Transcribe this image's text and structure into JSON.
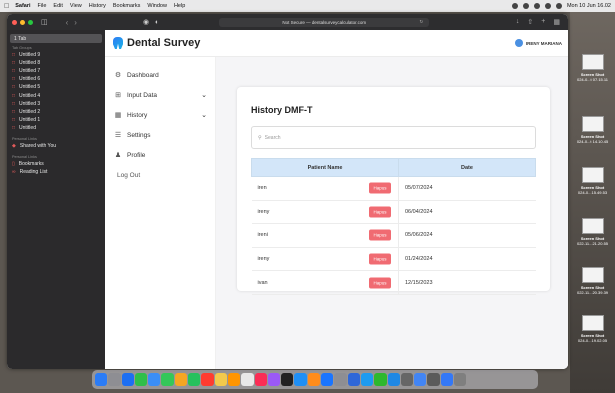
{
  "menubar": {
    "items": [
      "Safari",
      "File",
      "Edit",
      "View",
      "History",
      "Bookmarks",
      "Window",
      "Help"
    ],
    "clock": "Mon 10 Jun 16.02"
  },
  "browser": {
    "url": "Not Secure — dentalsurveycalculator.com",
    "sidebar": {
      "tab_label": "1 Tab",
      "groups_heading": "Tab Groups",
      "groups": [
        "Untitled 9",
        "Untitled 8",
        "Untitled 7",
        "Untitled 6",
        "Untitled 5",
        "Untitled 4",
        "Untitled 3",
        "Untitled 2",
        "Untitled 1",
        "Untitled"
      ],
      "shared_heading": "Personal Links",
      "shared": "Shared with You",
      "bookmarks_heading": "Personal Links",
      "bookmarks": [
        "Bookmarks",
        "Reading List"
      ]
    }
  },
  "app": {
    "title": "Dental Survey",
    "user_name": "IRENY MARIANA",
    "nav": [
      {
        "label": "Dashboard",
        "icon": "dashboard-icon"
      },
      {
        "label": "Input Data",
        "icon": "input-icon"
      },
      {
        "label": "History",
        "icon": "calendar-icon"
      },
      {
        "label": "Settings",
        "icon": "settings-icon"
      },
      {
        "label": "Profile",
        "icon": "profile-icon"
      }
    ],
    "logout": "Log Out",
    "page_title": "History DMF-T",
    "search_placeholder": "Search",
    "table": {
      "headers": [
        "Patient Name",
        "Date"
      ],
      "delete_label": "Hapus",
      "rows": [
        {
          "name": "iren",
          "date": "05/07/2024"
        },
        {
          "name": "ireny",
          "date": "06/04/2024"
        },
        {
          "name": "ireni",
          "date": "05/06/2024"
        },
        {
          "name": "ireny",
          "date": "01/24/2024"
        },
        {
          "name": "ivan",
          "date": "12/15/2023"
        }
      ]
    }
  },
  "desktop": {
    "files": [
      {
        "title": "Screen Shot",
        "sub": "024-0...t 07.15.11"
      },
      {
        "title": "Screen Shot",
        "sub": "024-0...t 14.10.45"
      },
      {
        "title": "Screen Shot",
        "sub": "024-0...15.49.53"
      },
      {
        "title": "Screen Shot",
        "sub": "022-11...21.20.55"
      },
      {
        "title": "Screen Shot",
        "sub": "022-11...20.39.39"
      },
      {
        "title": "Screen Shot",
        "sub": "024-0...19.02.05"
      }
    ]
  },
  "colors": {
    "accent": "#2f7bf5",
    "table_header": "#d3e6f9",
    "delete": "#f06b72",
    "sidebar_bg": "#2b2a2c"
  }
}
